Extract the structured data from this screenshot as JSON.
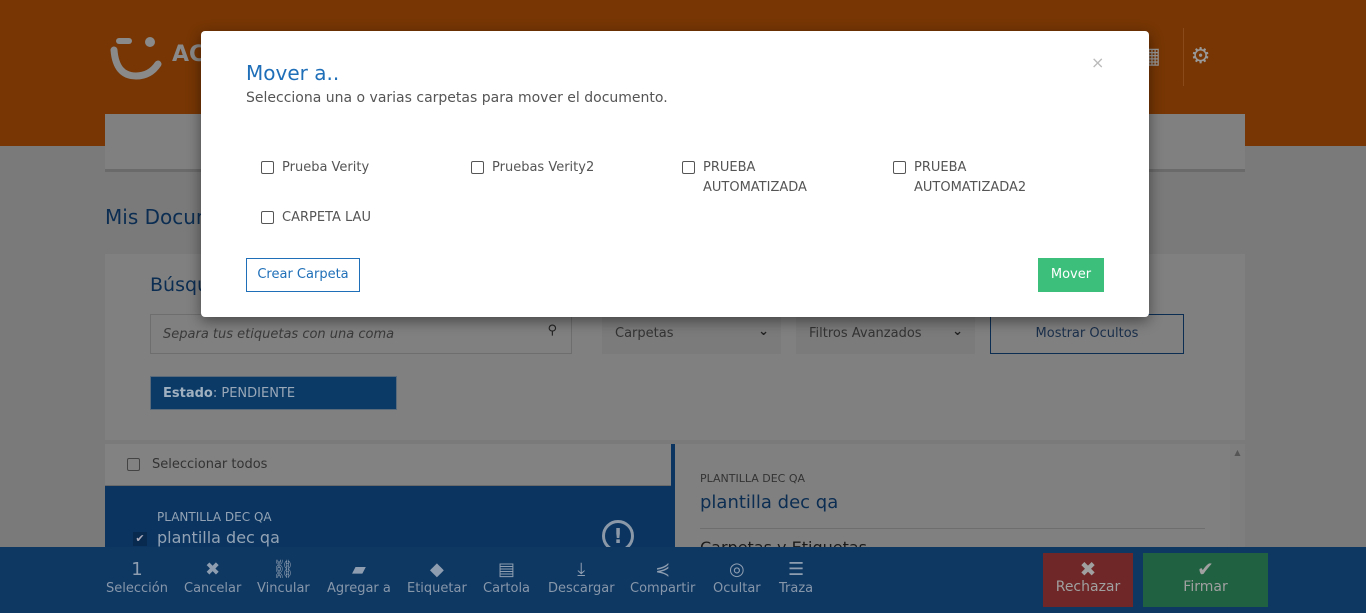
{
  "header": {
    "logo_text": "AC",
    "icons": [
      "grid-icon",
      "gear-icon"
    ]
  },
  "page": {
    "title": "Mis Documentos"
  },
  "search_card": {
    "title": "Búsqueda",
    "search_placeholder": "Separa tus etiquetas con una coma",
    "folders_select": "Carpetas",
    "filters_select": "Filtros Avanzados",
    "show_hidden": "Mostrar Ocultos",
    "estado_label": "Estado",
    "estado_value": ": PENDIENTE"
  },
  "list": {
    "select_all": "Seleccionar todos",
    "items": [
      {
        "type": "PLANTILLA DEC QA",
        "name": "plantilla dec qa",
        "checked": true
      }
    ]
  },
  "detail": {
    "type": "PLANTILLA DEC QA",
    "name": "plantilla dec qa",
    "section": "Carpetas y Etiquetas"
  },
  "toolbar": {
    "count": "1",
    "items": [
      {
        "label": "Selección"
      },
      {
        "label": "Cancelar",
        "icon": "✖"
      },
      {
        "label": "Vincular",
        "icon": "🔗"
      },
      {
        "label": "Agregar a",
        "icon": "▰"
      },
      {
        "label": "Etiquetar",
        "icon": "◆"
      },
      {
        "label": "Cartola",
        "icon": "▤"
      },
      {
        "label": "Descargar",
        "icon": "⤓"
      },
      {
        "label": "Compartir",
        "icon": "<"
      },
      {
        "label": "Ocultar",
        "icon": "◎"
      },
      {
        "label": "Traza",
        "icon": "☰"
      }
    ],
    "reject": "Rechazar",
    "sign": "Firmar"
  },
  "modal": {
    "title": "Mover a..",
    "subtitle": "Selecciona una o varias carpetas para mover el documento.",
    "close": "×",
    "folders": [
      "Prueba Verity",
      "Pruebas Verity2",
      "PRUEBA AUTOMATIZADA",
      "PRUEBA AUTOMATIZADA2",
      "CARPETA LAU"
    ],
    "create_button": "Crear Carpeta",
    "move_button": "Mover"
  }
}
